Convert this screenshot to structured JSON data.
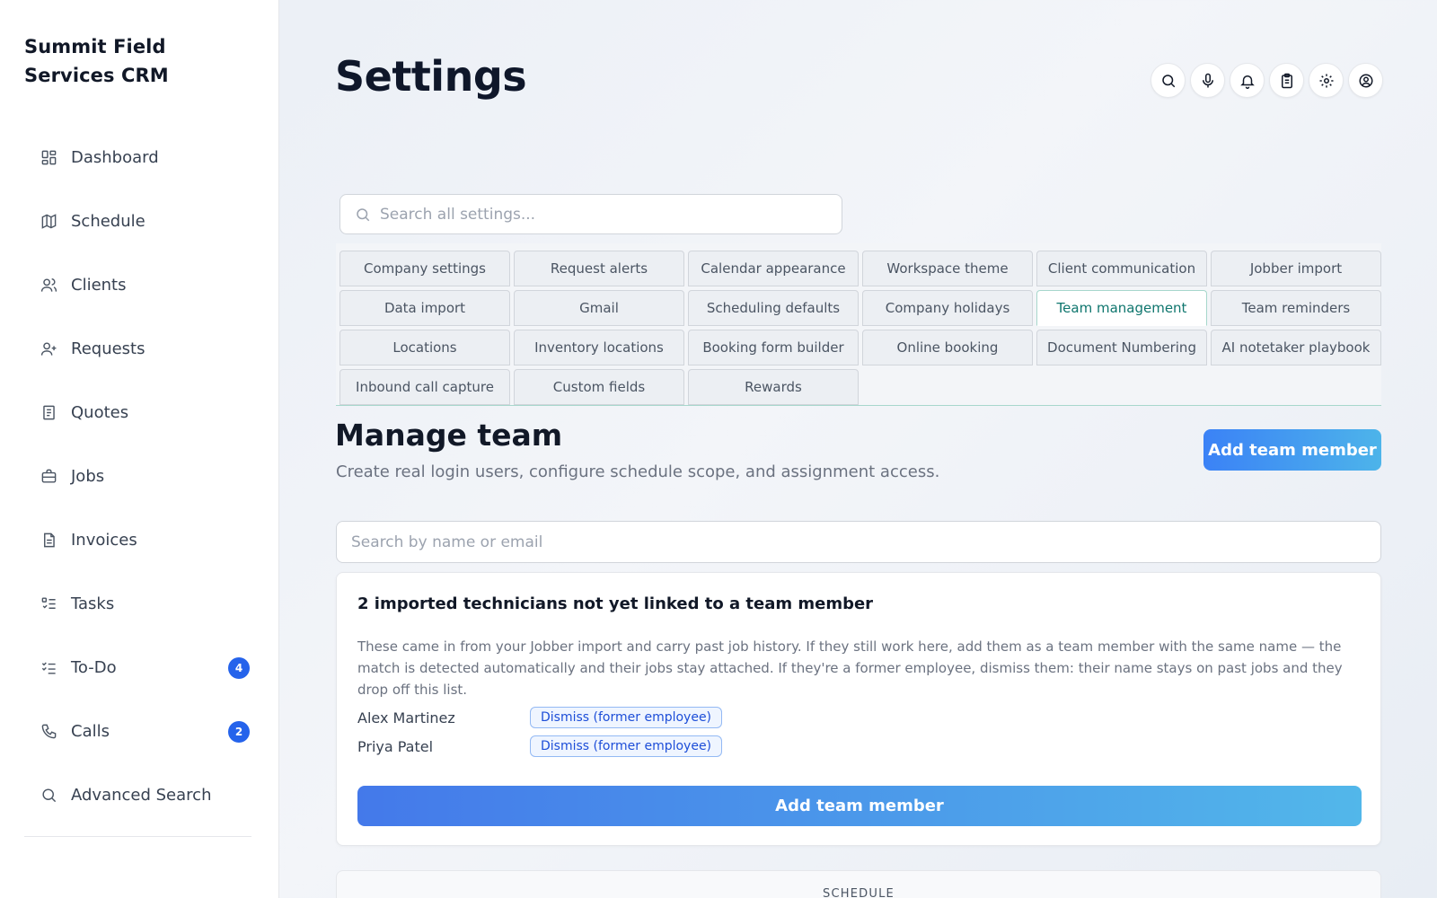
{
  "sidebar": {
    "brand": "Summit Field Services CRM",
    "items": [
      {
        "label": "Dashboard",
        "icon": "dashboard-icon"
      },
      {
        "label": "Schedule",
        "icon": "map-icon"
      },
      {
        "label": "Clients",
        "icon": "users-icon"
      },
      {
        "label": "Requests",
        "icon": "user-plus-icon"
      },
      {
        "label": "Quotes",
        "icon": "quote-doc-icon"
      },
      {
        "label": "Jobs",
        "icon": "briefcase-icon"
      },
      {
        "label": "Invoices",
        "icon": "invoice-icon"
      },
      {
        "label": "Tasks",
        "icon": "task-list-icon"
      },
      {
        "label": "To-Do",
        "icon": "checklist-icon",
        "badge": "4"
      },
      {
        "label": "Calls",
        "icon": "phone-icon",
        "badge": "2"
      },
      {
        "label": "Advanced Search",
        "icon": "search-icon"
      }
    ]
  },
  "header": {
    "title": "Settings",
    "icons": [
      "search-icon",
      "microphone-icon",
      "bell-icon",
      "clipboard-icon",
      "gear-icon",
      "user-circle-icon"
    ]
  },
  "settings_search": {
    "placeholder": "Search all settings..."
  },
  "tabs": [
    "Company settings",
    "Request alerts",
    "Calendar appearance",
    "Workspace theme",
    "Client communication",
    "Jobber import",
    "Data import",
    "Gmail",
    "Scheduling defaults",
    "Company holidays",
    "Team management",
    "Team reminders",
    "Locations",
    "Inventory locations",
    "Booking form builder",
    "Online booking",
    "Document Numbering",
    "AI notetaker playbook",
    "Inbound call capture",
    "Custom fields",
    "Rewards"
  ],
  "active_tab": "Team management",
  "section": {
    "title": "Manage team",
    "subtitle": "Create real login users, configure schedule scope, and assignment access.",
    "add_button": "Add team member"
  },
  "team_search": {
    "placeholder": "Search by name or email"
  },
  "card": {
    "title": "2 imported technicians not yet linked to a team member",
    "description": "These came in from your Jobber import and carry past job history. If they still work here, add them as a team member with the same name — the match is detected automatically and their jobs stay attached. If they're a former employee, dismiss them: their name stays on past jobs and they drop off this list.",
    "technicians": [
      {
        "name": "Alex Martinez",
        "action": "Dismiss (former employee)"
      },
      {
        "name": "Priya Patel",
        "action": "Dismiss (former employee)"
      }
    ],
    "add_button": "Add team member"
  },
  "schedule_panel": {
    "label": "SCHEDULE"
  },
  "colors": {
    "accent": "#3b82f6",
    "active_tab": "#0f766e",
    "badge": "#2563eb"
  }
}
